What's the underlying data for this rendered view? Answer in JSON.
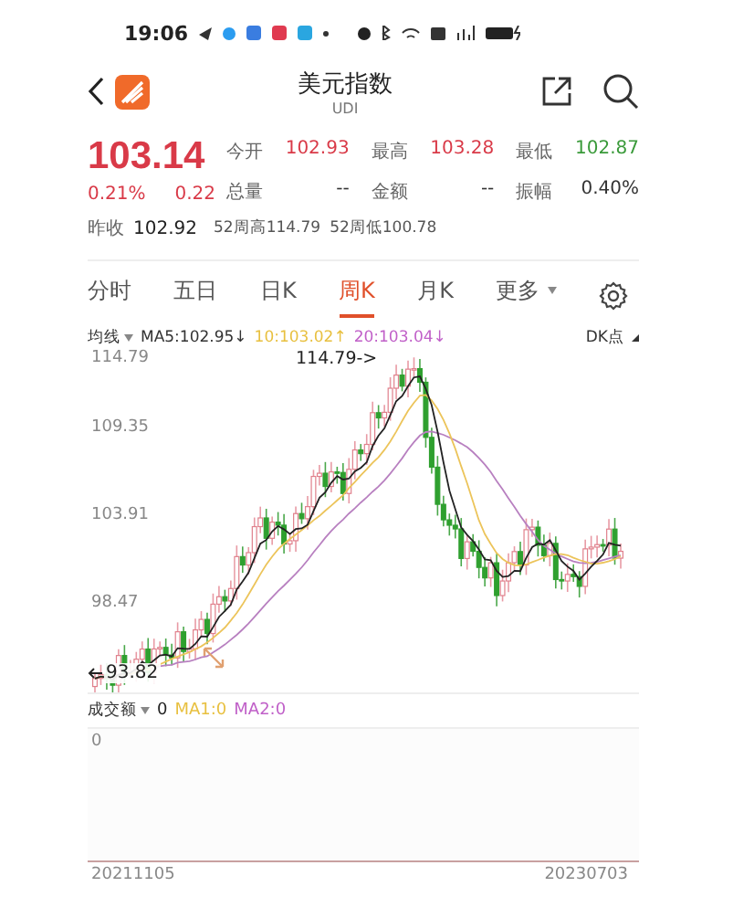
{
  "status_bar": {
    "time": "19:06"
  },
  "header": {
    "title": "美元指数",
    "subtitle": "UDI"
  },
  "quote": {
    "price": "103.14",
    "change_pct": "0.21%",
    "change": "0.22",
    "color": "#d93a48",
    "stats": [
      {
        "label": "今开",
        "value": "102.93",
        "color": "#d93a48"
      },
      {
        "label": "最高",
        "value": "103.28",
        "color": "#d93a48"
      },
      {
        "label": "最低",
        "value": "102.87",
        "color": "#3a9a3a"
      },
      {
        "label": "总量",
        "value": "--",
        "color": "#333333"
      },
      {
        "label": "金额",
        "value": "--",
        "color": "#333333"
      },
      {
        "label": "振幅",
        "value": "0.40%",
        "color": "#333333"
      }
    ],
    "prev_close": {
      "label": "昨收",
      "value": "102.92"
    },
    "week52": [
      {
        "label": "52周高",
        "value": "114.79"
      },
      {
        "label": "52周低",
        "value": "100.78"
      }
    ]
  },
  "tabs": [
    {
      "label": "分时",
      "selected": false,
      "has_menu": false
    },
    {
      "label": "五日",
      "selected": false,
      "has_menu": false
    },
    {
      "label": "日K",
      "selected": false,
      "has_menu": false
    },
    {
      "label": "周K",
      "selected": true,
      "has_menu": false
    },
    {
      "label": "月K",
      "selected": false,
      "has_menu": false
    },
    {
      "label": "更多",
      "selected": false,
      "has_menu": true
    }
  ],
  "indicator": {
    "label": "均线",
    "values": [
      {
        "text": "MA5:102.95↓",
        "color": "#333333"
      },
      {
        "text": "10:103.02↑",
        "color": "#e8c040"
      },
      {
        "text": "20:103.04↓",
        "color": "#c060c8"
      }
    ],
    "mode": "DK点"
  },
  "chart": {
    "y_labels": [
      "114.79",
      "109.35",
      "103.91",
      "98.47"
    ],
    "high_marker": "114.79->",
    "low_marker": "93.82"
  },
  "volume": {
    "label": "成交额",
    "value": "0",
    "values": [
      {
        "text": "MA1:0",
        "color": "#e8c040"
      },
      {
        "text": "MA2:0",
        "color": "#c060c8"
      }
    ],
    "axis_label": "0"
  },
  "dates": [
    "20211105",
    "20230703"
  ]
}
